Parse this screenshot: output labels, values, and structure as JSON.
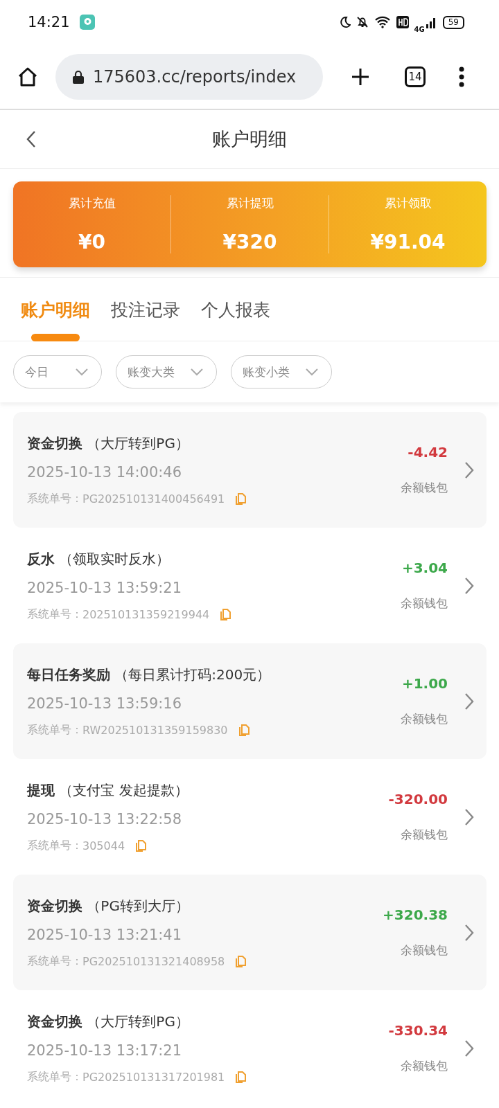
{
  "status_bar": {
    "time": "14:21",
    "battery": "59",
    "network": "4G"
  },
  "browser": {
    "url": "175603.cc/reports/index",
    "tab_count": "14"
  },
  "header": {
    "title": "账户明细"
  },
  "summary": [
    {
      "label": "累计充值",
      "value": "¥0"
    },
    {
      "label": "累计提现",
      "value": "¥320"
    },
    {
      "label": "累计领取",
      "value": "¥91.04"
    }
  ],
  "tabs": [
    {
      "label": "账户明细",
      "selected": true
    },
    {
      "label": "投注记录",
      "selected": false
    },
    {
      "label": "个人报表",
      "selected": false
    }
  ],
  "filters": [
    {
      "label": "今日"
    },
    {
      "label": "账变大类"
    },
    {
      "label": "账变小类"
    }
  ],
  "records": [
    {
      "title": "**资金切换** （大厅转到PG）",
      "time": "2025-10-13 14:00:46",
      "order_label": "系统单号：",
      "order_no": "PG202510131400456491",
      "amount": "-4.42",
      "color": "#d2393e",
      "wallet": "余额钱包"
    },
    {
      "title": "**反水** （领取实时反水）",
      "time": "2025-10-13 13:59:21",
      "order_label": "系统单号：",
      "order_no": "202510131359219944",
      "amount": "+3.04",
      "color": "#3ca84a",
      "wallet": "余额钱包"
    },
    {
      "title": "**每日任务奖励** （每日累计打码:200元）",
      "time": "2025-10-13 13:59:16",
      "order_label": "系统单号：",
      "order_no": "RW202510131359159830",
      "amount": "+1.00",
      "color": "#3ca84a",
      "wallet": "余额钱包"
    },
    {
      "title": "**提现** （支付宝 发起提款）",
      "time": "2025-10-13 13:22:58",
      "order_label": "系统单号：",
      "order_no": "305044",
      "amount": "-320.00",
      "color": "#d2393e",
      "wallet": "余额钱包"
    },
    {
      "title": "**资金切换** （PG转到大厅）",
      "time": "2025-10-13 13:21:41",
      "order_label": "系统单号：",
      "order_no": "PG202510131321408958",
      "amount": "+320.38",
      "color": "#3ca84a",
      "wallet": "余额钱包"
    },
    {
      "title": "**资金切换** （大厅转到PG）",
      "time": "2025-10-13 13:17:21",
      "order_label": "系统单号：",
      "order_no": "PG202510131317201981",
      "amount": "-330.34",
      "color": "#d2393e",
      "wallet": "余额钱包"
    }
  ]
}
